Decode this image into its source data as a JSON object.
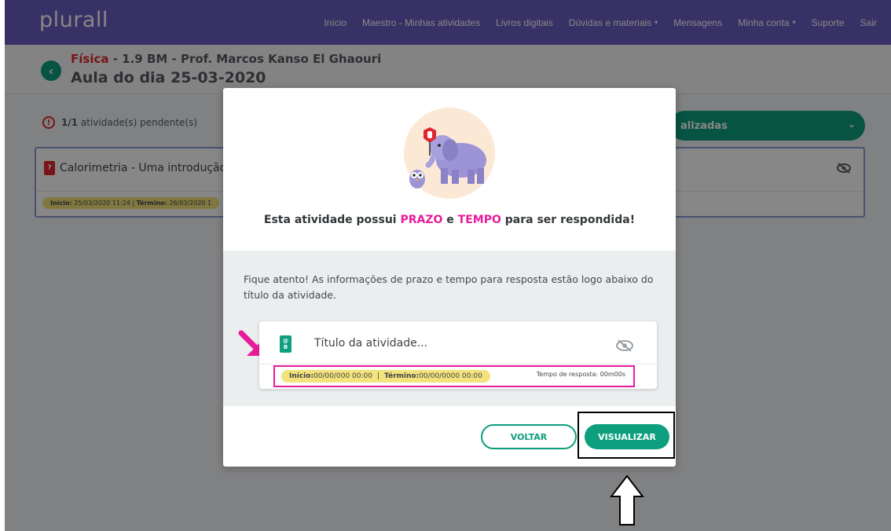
{
  "navbar": {
    "logo": "plurall",
    "links": [
      {
        "label": "Início"
      },
      {
        "label": "Maestro - Minhas atividades"
      },
      {
        "label": "Livros digitais"
      },
      {
        "label": "Dúvidas e materiais",
        "caret": "▾"
      },
      {
        "label": "Mensagens"
      },
      {
        "label": "Minha conta",
        "caret": "▾"
      },
      {
        "label": "Suporte"
      },
      {
        "label": "Sair"
      }
    ]
  },
  "header": {
    "subject": "Física",
    "subtitle_rest": " - 1.9 BM - Prof. Marcos Kanso El Ghaouri",
    "title": "Aula do dia 25-03-2020",
    "back_icon": "chevron-left-icon"
  },
  "pending": {
    "icon": "alert-circle-icon",
    "count": "1/1",
    "text": " atividade(s) pendente(s)"
  },
  "filter": {
    "label": "alizadas",
    "icon": "chevron-down-icon"
  },
  "activity": {
    "title": "Calorimetria - Uma introdução",
    "dates_start_label": "Início:",
    "dates_start": " 25/03/2020 11:24 | ",
    "dates_end_label": "Término:",
    "dates_end": " 26/03/2020 1"
  },
  "modal": {
    "heading_part1": "Esta atividade possui ",
    "heading_hl1": "PRAZO",
    "heading_part2": " e ",
    "heading_hl2": "TEMPO",
    "heading_part3": " para ser respondida!",
    "note": "Fique atento! As informações de prazo e tempo para resposta estão logo abaixo do título da atividade.",
    "preview": {
      "icon_top": "@",
      "icon_bottom": "B",
      "title": "Título da atividade...",
      "start_label": "Início:",
      "start_value": " 00/00/000 00:00",
      "separator": "|",
      "end_label": "Término:",
      "end_value": " 00/00/0000 00:00",
      "response_time": "Tempo de resposta: 00m00s"
    },
    "buttons": {
      "back": "VOLTAR",
      "view": "VISUALIZAR"
    }
  },
  "colors": {
    "nav": "#6a5dc0",
    "accent_green": "#0e9f7e",
    "highlight_pink": "#e81c9b",
    "date_badge": "#f3e37c",
    "subject_red": "#e0262e"
  }
}
